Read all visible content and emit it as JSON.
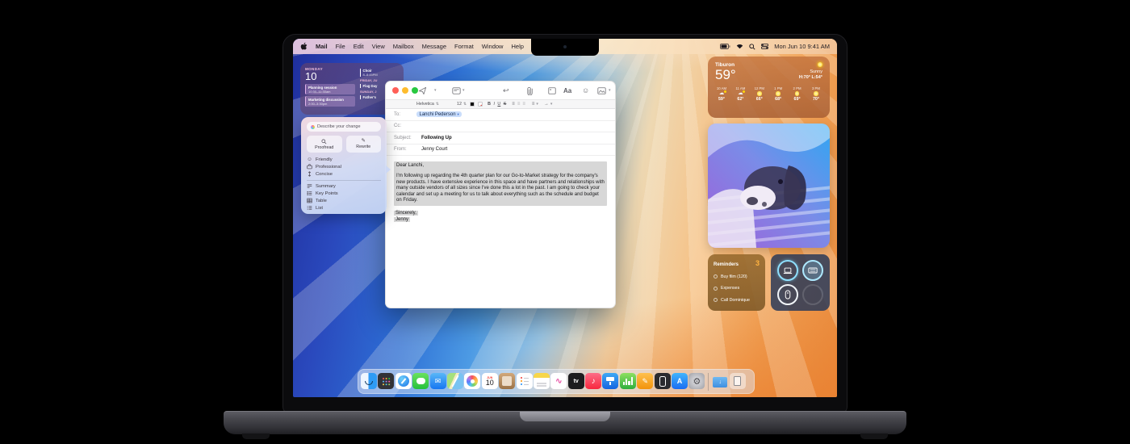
{
  "menu_bar": {
    "items": [
      "Mail",
      "File",
      "Edit",
      "View",
      "Mailbox",
      "Message",
      "Format",
      "Window",
      "Help"
    ],
    "clock": "Mon Jun 10  9:41 AM"
  },
  "calendar_widget": {
    "day_label": "MONDAY",
    "day_number": "10",
    "events": [
      {
        "title": "Planning session",
        "time": "10:30–11:30am"
      },
      {
        "title": "Marketing discussion",
        "time": "2:00–3:30pm"
      }
    ],
    "upcoming": [
      {
        "day": "",
        "title": "Choir",
        "time": "8–8:45PM"
      },
      {
        "day": "FRIDAY, JU",
        "title": "Flag Day",
        "time": ""
      },
      {
        "day": "SUNDAY, J",
        "title": "Father's",
        "time": ""
      }
    ]
  },
  "writing_tools": {
    "prompt": "Describe your change",
    "actions": [
      {
        "label": "Proofread"
      },
      {
        "label": "Rewrite"
      }
    ],
    "tones": [
      {
        "label": "Friendly"
      },
      {
        "label": "Professional"
      },
      {
        "label": "Concise"
      }
    ],
    "transforms": [
      {
        "label": "Summary"
      },
      {
        "label": "Key Points"
      },
      {
        "label": "Table"
      },
      {
        "label": "List"
      }
    ]
  },
  "mail_compose": {
    "toolbar_aa": "Aa",
    "format_bar": {
      "font_name": "Helvetica",
      "font_size": "12",
      "bold": "B",
      "italic": "I",
      "underline": "U",
      "strike": "S"
    },
    "fields": {
      "to_label": "To:",
      "to_value": "Lanchi Pederson",
      "cc_label": "Cc:",
      "subject_label": "Subject:",
      "subject_value": "Following Up",
      "from_label": "From:",
      "from_value": "Jenny Court"
    },
    "body": {
      "salutation": "Dear Lanchi,",
      "paragraph": "I'm following up regarding the 4th quarter plan for our Go-to-Market strategy for the company's new products. I have extensive experience in this space and have partners and relationships with many outside vendors of all sizes since I've done this a lot in the past. I am going to check your calendar and set up a meeting for us to talk about everything such as the schedule and budget on Friday.",
      "closing": "Sincerely,",
      "signature": "Jenny"
    }
  },
  "weather_widget": {
    "city": "Tiburon",
    "temp": "59°",
    "condition": "Sunny",
    "high_low": "H:70° L:54°",
    "hourly": [
      {
        "time": "10 AM",
        "icon": "partly-cloudy",
        "temp": "59°"
      },
      {
        "time": "11 AM",
        "icon": "partly-cloudy",
        "temp": "62°"
      },
      {
        "time": "12 PM",
        "icon": "sunny",
        "temp": "66°"
      },
      {
        "time": "1 PM",
        "icon": "sunny",
        "temp": "68°"
      },
      {
        "time": "2 PM",
        "icon": "sunny",
        "temp": "69°"
      },
      {
        "time": "3 PM",
        "icon": "sunny",
        "temp": "70°"
      }
    ]
  },
  "reminders_widget": {
    "title": "Reminders",
    "count": "3",
    "items": [
      {
        "label": "Buy film (120)"
      },
      {
        "label": "Expenses"
      },
      {
        "label": "Call Dominique"
      }
    ]
  },
  "devices_widget": {
    "devices": [
      "macbook",
      "keyboard",
      "mouse"
    ]
  },
  "dock": {
    "apps": [
      "Finder",
      "Launchpad",
      "Safari",
      "Messages",
      "Mail",
      "Maps",
      "Photos",
      "Calendar",
      "Contacts",
      "Reminders",
      "Notes",
      "Freeform",
      "Apple TV",
      "Music",
      "Keynote",
      "Numbers",
      "Pages",
      "iPhone Mirroring",
      "App Store",
      "System Settings",
      "Downloads",
      "Trash"
    ],
    "calendar_month": "JUN",
    "calendar_day": "10",
    "appletv_label": "tv",
    "appstore_label": "A"
  },
  "colors": {
    "accent_blue": "#0a7cff",
    "selection_gray": "#d7d7d7",
    "reminder_badge": "#ffb340",
    "active_ring": "#8fe0ff"
  }
}
